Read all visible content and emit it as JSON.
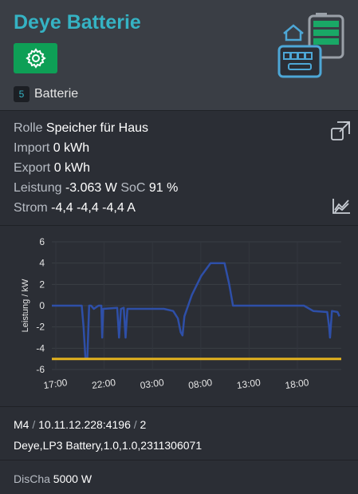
{
  "header": {
    "title": "Deye Batterie",
    "badge": "5",
    "category": "Batterie"
  },
  "info": {
    "rolle_label": "Rolle",
    "rolle_value": "Speicher für Haus",
    "import_label": "Import",
    "import_value": "0 kWh",
    "export_label": "Export",
    "export_value": "0 kWh",
    "leistung_label": "Leistung",
    "leistung_value": "-3.063 W",
    "soc_label": "SoC",
    "soc_value": "91 %",
    "strom_label": "Strom",
    "strom_value": "-4,4 -4,4 -4,4 A"
  },
  "chart_data": {
    "type": "line",
    "ylabel": "Leistung / kW",
    "xlabel": "",
    "ylim": [
      -6,
      6
    ],
    "yticks": [
      "6",
      "4",
      "2",
      "0",
      "-2",
      "-4",
      "-6"
    ],
    "xticks": [
      "17:00",
      "22:00",
      "03:00",
      "08:00",
      "13:00",
      "18:00"
    ],
    "grid": true,
    "series": [
      {
        "color": "#2e4fa8",
        "points": [
          [
            0,
            0
          ],
          [
            3.2,
            0
          ],
          [
            3.4,
            -2
          ],
          [
            3.6,
            -5
          ],
          [
            3.8,
            -5
          ],
          [
            4.0,
            0
          ],
          [
            4.2,
            0
          ],
          [
            4.5,
            -0.3
          ],
          [
            5.0,
            0
          ],
          [
            5.3,
            0
          ],
          [
            5.4,
            -3
          ],
          [
            5.5,
            -0.3
          ],
          [
            7.0,
            -0.2
          ],
          [
            7.2,
            -3.0
          ],
          [
            7.4,
            -0.3
          ],
          [
            7.7,
            -0.2
          ],
          [
            7.9,
            -3
          ],
          [
            8.1,
            -0.3
          ],
          [
            12.0,
            -0.3
          ],
          [
            13.0,
            -0.5
          ],
          [
            13.5,
            -1.2
          ],
          [
            13.8,
            -2.5
          ],
          [
            14.0,
            -2.8
          ],
          [
            14.2,
            -1.0
          ],
          [
            15.0,
            1.0
          ],
          [
            16.0,
            2.8
          ],
          [
            17.0,
            4.0
          ],
          [
            18.5,
            4.0
          ],
          [
            19.0,
            2.0
          ],
          [
            19.4,
            0
          ],
          [
            24.0,
            0
          ],
          [
            27.0,
            0
          ],
          [
            28.0,
            -0.5
          ],
          [
            29.5,
            -0.6
          ],
          [
            29.7,
            -2.0
          ],
          [
            29.8,
            -3.0
          ],
          [
            30.0,
            -0.5
          ],
          [
            30.6,
            -0.6
          ],
          [
            30.8,
            -1.0
          ]
        ]
      },
      {
        "color": "#e3b21f",
        "points": [
          [
            0,
            -5
          ],
          [
            31,
            -5
          ]
        ]
      }
    ]
  },
  "meta": {
    "line1_a": "M4",
    "line1_sep1": "/",
    "line1_b": "10.11.12.228:4196",
    "line1_sep2": "/",
    "line1_c": "2",
    "line2": "Deye,LP3 Battery,1.0,1.0,2311306071"
  },
  "footer": {
    "dischar_label": "DisCha",
    "dischar_value": "5000 W"
  },
  "colors": {
    "accent": "#35b3c4",
    "button": "#0e9f56",
    "series_power": "#2e4fa8",
    "series_limit": "#e3b21f"
  },
  "icons": [
    "gear-icon",
    "house-battery-meter-icon",
    "expand-icon",
    "line-chart-icon"
  ]
}
